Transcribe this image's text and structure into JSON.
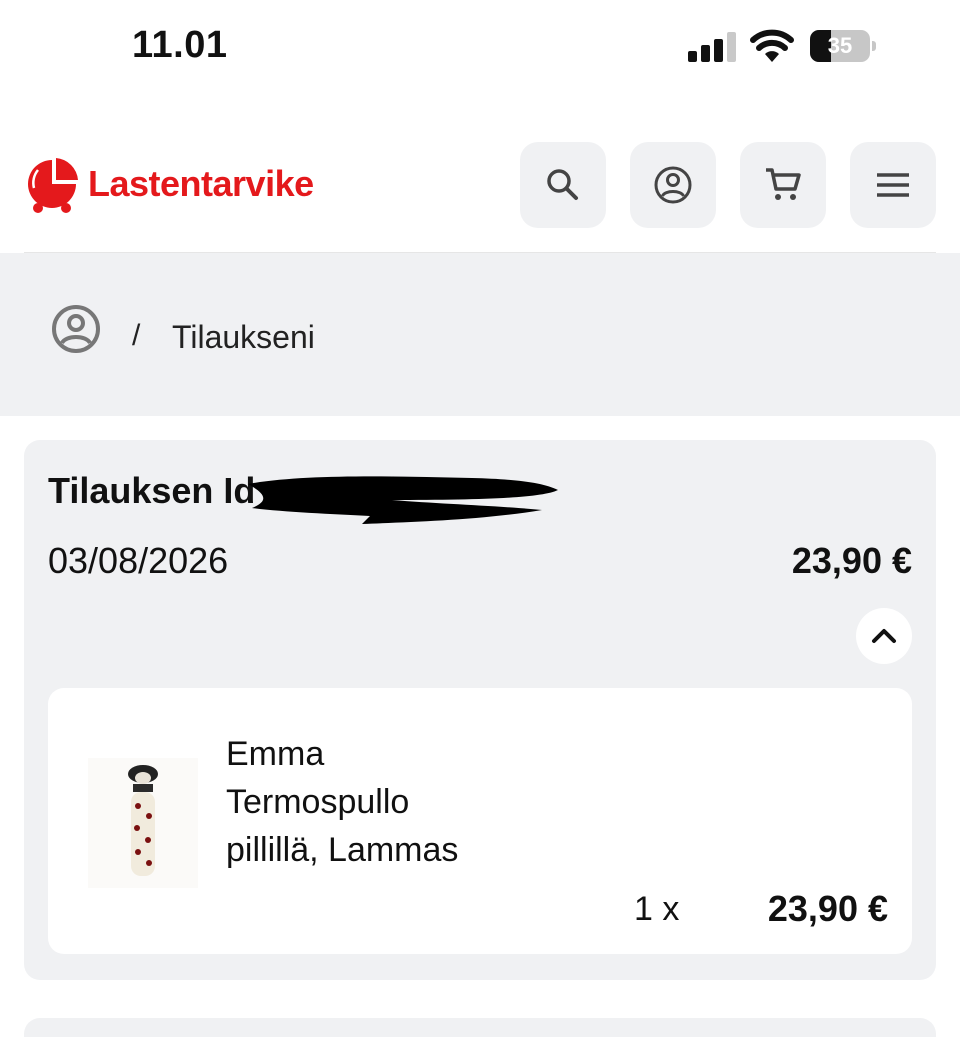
{
  "status_bar": {
    "time": "11.01",
    "battery_level": "35",
    "signal_bars": 3,
    "signal_bars_total": 4
  },
  "header": {
    "logo_text": "Lastentarvike",
    "brand_color": "#e4191c",
    "buttons": [
      {
        "icon": "search-icon"
      },
      {
        "icon": "user-icon"
      },
      {
        "icon": "cart-icon"
      },
      {
        "icon": "menu-icon"
      }
    ]
  },
  "breadcrumb": {
    "home_icon": "user-icon",
    "separator": "/",
    "current": "Tilaukseni"
  },
  "order": {
    "title_label": "Tilauksen Id",
    "date": "03/08/2026",
    "total": "23,90 €",
    "expanded": true,
    "items": [
      {
        "name": "Emma Termospullo pillillä, Lammas",
        "quantity": "1 x",
        "price": "23,90 €"
      }
    ]
  },
  "colors": {
    "card_bg": "#f0f1f3",
    "brand_red": "#e4191c"
  }
}
